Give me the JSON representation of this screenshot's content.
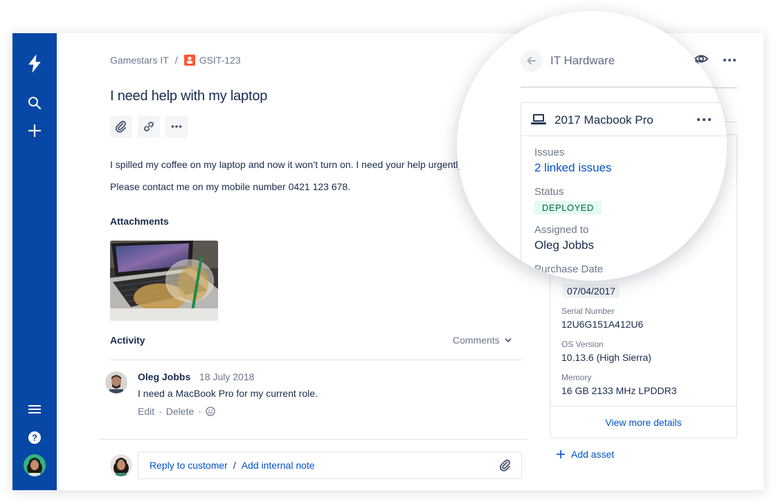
{
  "breadcrumb": {
    "project": "Gamestars IT",
    "separator": "/",
    "issue_key": "GSIT-123"
  },
  "issue": {
    "title": "I need help with my laptop",
    "description": [
      "I spilled my coffee on my laptop and now it won’t turn on. I need your help urgently.",
      "Please contact me on my mobile number 0421 123 678."
    ]
  },
  "toolbar": {
    "icons": [
      "paperclip-icon",
      "link-icon",
      "more-icon"
    ]
  },
  "attachments": {
    "heading": "Attachments"
  },
  "activity": {
    "heading": "Activity",
    "filter": "Comments",
    "comment": {
      "author": "Oleg Jobbs",
      "date": "18 July 2018",
      "body": "I need a MacBook Pro for my current role.",
      "edit": "Edit",
      "dot": "·",
      "delete": "Delete"
    }
  },
  "reply": {
    "reply_label": "Reply to customer",
    "separator": "/",
    "note_label": "Add internal note"
  },
  "right_panel": {
    "header": "IT Hardware",
    "asset": {
      "name": "2017 Macbook Pro",
      "issues_label": "Issues",
      "issues_value": "2 linked issues",
      "status_label": "Status",
      "status_value": "DEPLOYED",
      "assigned_label": "Assigned to",
      "assigned_value": "Oleg Jobbs",
      "purchase_label": "Purchase Date",
      "purchase_value": "07/04/2017",
      "serial_label": "Serial Number",
      "serial_value": "12U6G151A412U6",
      "os_label": "OS Version",
      "os_value": "10.13.6 (High Sierra)",
      "memory_label": "Memory",
      "memory_value": "16 GB 2133 MHz LPDDR3"
    },
    "view_more": "View more details",
    "add_asset": "Add asset"
  },
  "colors": {
    "nav": "#0747A6",
    "link": "#0052CC",
    "text": "#172B4D",
    "muted": "#6B778C",
    "deployed_bg": "#E3FCEF",
    "deployed_text": "#006644",
    "issue_icon": "#FF5630"
  }
}
